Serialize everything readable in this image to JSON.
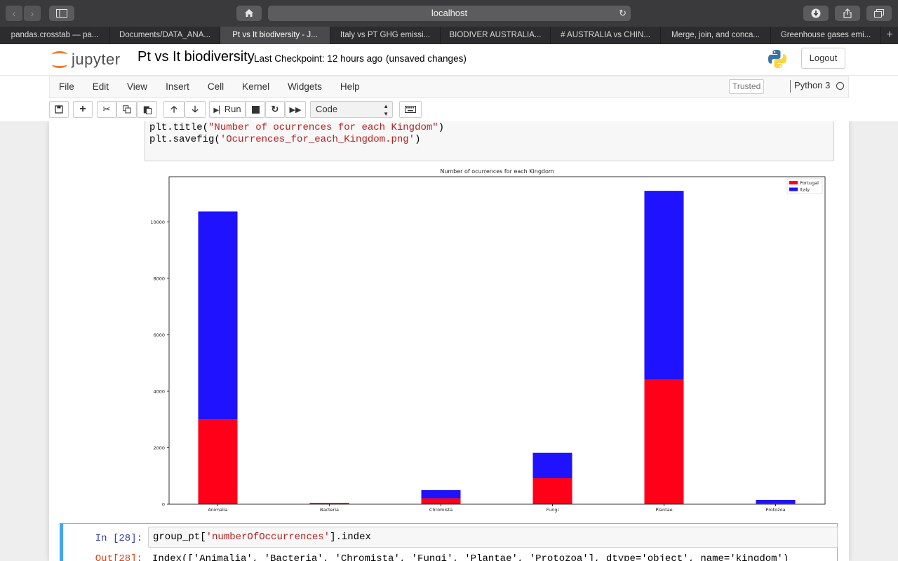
{
  "browser": {
    "address": "localhost",
    "tabs": [
      {
        "label": "pandas.crosstab — pa..."
      },
      {
        "label": "Documents/DATA_ANA..."
      },
      {
        "label": "Pt vs It biodiversity - J..."
      },
      {
        "label": "Italy vs PT GHG emissi..."
      },
      {
        "label": "BIODIVER AUSTRALIA..."
      },
      {
        "label": "# AUSTRALIA vs CHIN..."
      },
      {
        "label": "Merge, join, and conca..."
      },
      {
        "label": "Greenhouse gases emi..."
      }
    ],
    "new_tab": "+"
  },
  "header": {
    "logo_text": "jupyter",
    "notebook_title": "Pt vs It biodiversity",
    "checkpoint": "Last Checkpoint: 12 hours ago",
    "unsaved": "(unsaved changes)",
    "logout": "Logout"
  },
  "menubar": {
    "items": [
      "File",
      "Edit",
      "View",
      "Insert",
      "Cell",
      "Kernel",
      "Widgets",
      "Help"
    ],
    "trusted": "Trusted",
    "kernel": "Python 3"
  },
  "toolbar": {
    "run": "Run",
    "cell_type": "Code"
  },
  "cell1": {
    "line1_pre": "plt.title(",
    "line1_str": "\"Number of ocurrences for each Kingdom\"",
    "line1_post": ")",
    "line2_pre": "plt.savefig(",
    "line2_str": "'Ocurrences_for_each_Kingdom.png'",
    "line2_post": ")"
  },
  "chart_data": {
    "type": "bar",
    "stacked": true,
    "title": "Number of ocurrences for each Kingdom",
    "xlabel": "",
    "ylabel": "",
    "categories": [
      "Animalia",
      "Bacteria",
      "Chromista",
      "Fungi",
      "Plantae",
      "Protozoa"
    ],
    "series": [
      {
        "name": "Portugal",
        "color": "#ff0018",
        "values": [
          3000,
          50,
          210,
          920,
          4420,
          30
        ]
      },
      {
        "name": "Italy",
        "color": "#1f12ff",
        "values": [
          7370,
          0,
          290,
          900,
          6680,
          120
        ]
      }
    ],
    "ylim": [
      0,
      11600
    ],
    "yticks": [
      0,
      2000,
      4000,
      6000,
      8000,
      10000
    ],
    "legend": "top-right",
    "grid": false
  },
  "cell2": {
    "prompt_in": "In [28]:",
    "code_pre": "group_pt[",
    "code_str": "'numberOfOccurrences'",
    "code_post": "].index",
    "prompt_out": "Out[28]:",
    "output": "Index(['Animalia', 'Bacteria', 'Chromista', 'Fungi', 'Plantae', 'Protozoa'], dtype='object', name='kingdom')"
  }
}
